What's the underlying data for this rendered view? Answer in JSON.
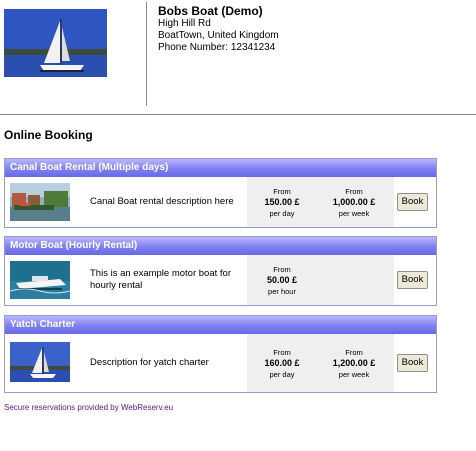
{
  "business": {
    "name": "Bobs Boat (Demo)",
    "address_line1": "High Hill Rd",
    "address_line2": "BoatTown, United Kingdom",
    "phone": "Phone Number: 12341234"
  },
  "section_title": "Online Booking",
  "items": [
    {
      "title": "Canal Boat Rental (Multiple days)",
      "description": "Canal Boat rental description here",
      "prices": [
        {
          "from": "From",
          "amount": "150.00 £",
          "unit": "per day"
        },
        {
          "from": "From",
          "amount": "1,000.00 £",
          "unit": "per week"
        }
      ],
      "book_label": "Book"
    },
    {
      "title": "Motor Boat (Hourly Rental)",
      "description": "This is an example motor boat for hourly rental",
      "prices": [
        {
          "from": "From",
          "amount": "50.00 £",
          "unit": "per hour"
        }
      ],
      "book_label": "Book"
    },
    {
      "title": "Yatch Charter",
      "description": "Description for yatch charter",
      "prices": [
        {
          "from": "From",
          "amount": "160.00 £",
          "unit": "per day"
        },
        {
          "from": "From",
          "amount": "1,200.00 £",
          "unit": "per week"
        }
      ],
      "book_label": "Book"
    }
  ],
  "footer": "Secure reservations provided by WebReserv.eu"
}
